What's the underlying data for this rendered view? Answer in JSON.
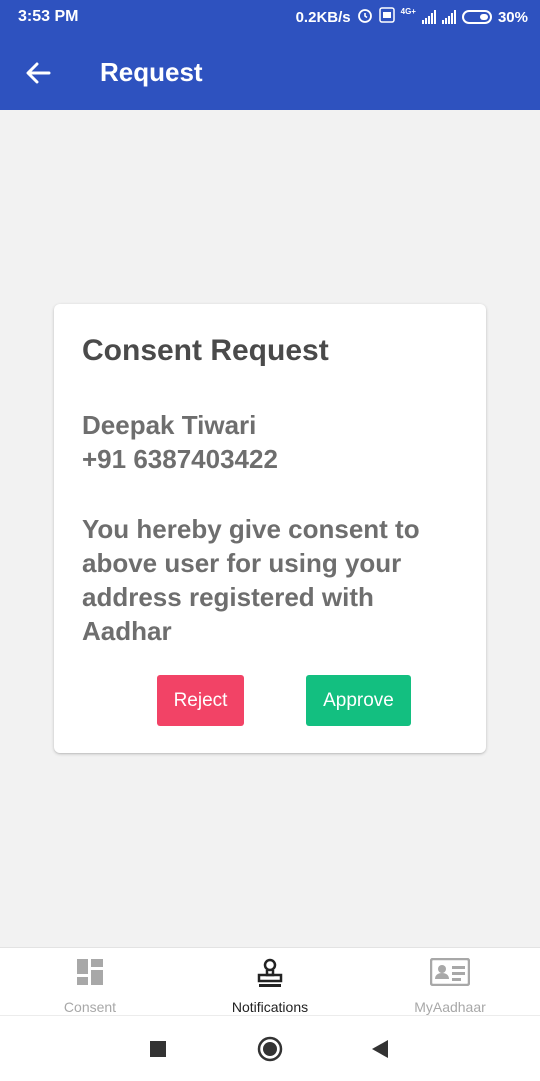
{
  "status_bar": {
    "time": "3:53 PM",
    "speed": "0.2KB/s",
    "network": "4G+",
    "battery": "30%"
  },
  "app_bar": {
    "title": "Request",
    "back_icon": "arrow-left-icon"
  },
  "consent_card": {
    "title": "Consent Request",
    "requester_name": "Deepak Tiwari",
    "requester_phone": "+91 6387403422",
    "message": "You hereby give consent to above user for using your address registered with Aadhar",
    "reject_label": "Reject",
    "approve_label": "Approve"
  },
  "bottom_nav": {
    "items": [
      {
        "label": "Consent",
        "icon": "dashboard-grid-icon",
        "active": false
      },
      {
        "label": "Notifications",
        "icon": "stamp-icon",
        "active": true
      },
      {
        "label": "MyAadhaar",
        "icon": "id-card-icon",
        "active": false
      }
    ]
  },
  "colors": {
    "app_bar": "#2e52bf",
    "reject": "#f24366",
    "approve": "#13bf80",
    "active_nav": "#222222",
    "inactive_nav": "#a8a8a8"
  }
}
